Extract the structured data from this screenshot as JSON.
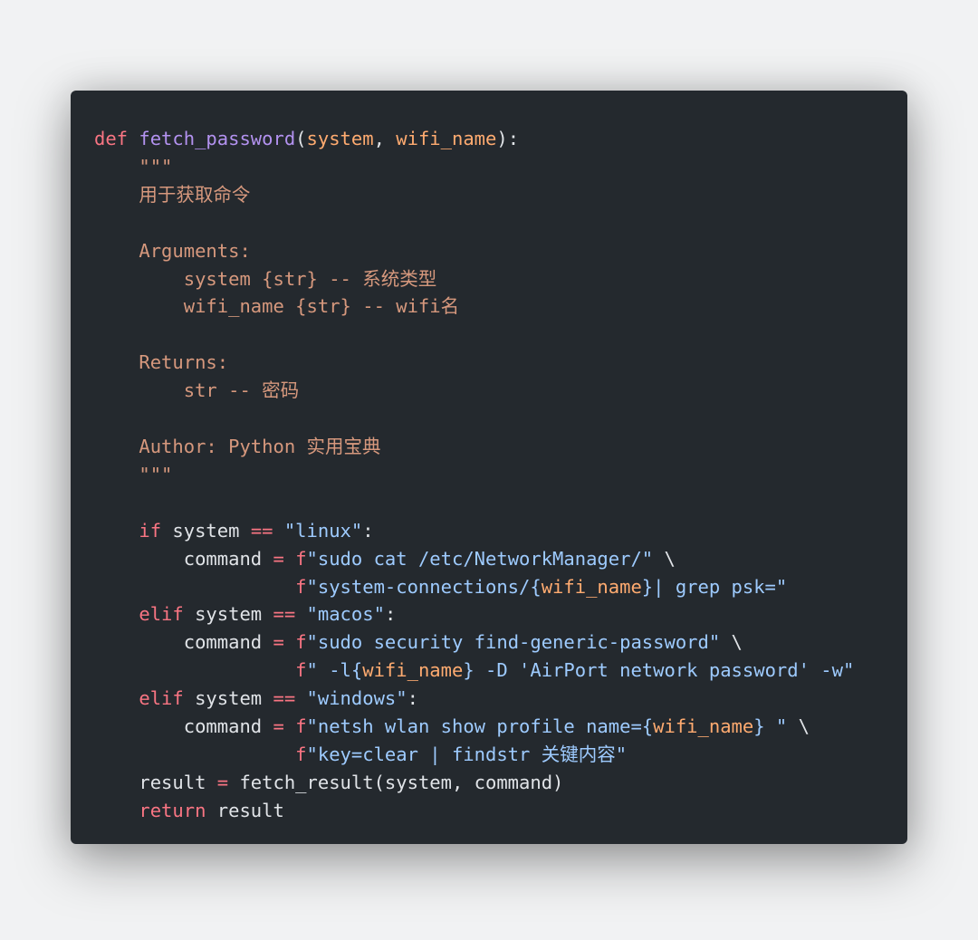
{
  "code": {
    "line01": {
      "def": "def",
      "sp1": " ",
      "fn": "fetch_password",
      "lp": "(",
      "arg1": "system",
      "comma": ", ",
      "arg2": "wifi_name",
      "rp": ")",
      "colon": ":"
    },
    "line02": {
      "indent": "    ",
      "q": "\"\"\""
    },
    "line03": {
      "indent": "    ",
      "t": "用于获取命令"
    },
    "line04": {
      "indent": ""
    },
    "line05": {
      "indent": "    ",
      "t": "Arguments:"
    },
    "line06": {
      "indent": "        ",
      "t": "system {str} -- 系统类型"
    },
    "line07": {
      "indent": "        ",
      "t": "wifi_name {str} -- wifi名"
    },
    "line08": {
      "indent": ""
    },
    "line09": {
      "indent": "    ",
      "t": "Returns:"
    },
    "line10": {
      "indent": "        ",
      "t": "str -- 密码"
    },
    "line11": {
      "indent": ""
    },
    "line12": {
      "indent": "    ",
      "t": "Author: Python 实用宝典"
    },
    "line13": {
      "indent": "    ",
      "q": "\"\"\""
    },
    "line14": {
      "indent": ""
    },
    "line15": {
      "indent": "    ",
      "ifkw": "if",
      "sp1": " ",
      "var": "system",
      "sp2": " ",
      "op": "==",
      "sp3": " ",
      "s": "\"linux\"",
      "colon": ":"
    },
    "line16": {
      "indent": "        ",
      "var": "command",
      "sp1": " ",
      "op": "=",
      "sp2": " ",
      "f": "f",
      "s": "\"sudo cat /etc/NetworkManager/\"",
      "sp3": " ",
      "bs": "\\"
    },
    "line17": {
      "indent": "                  ",
      "f": "f",
      "s1": "\"system-connections/",
      "lb": "{",
      "arg": "wifi_name",
      "rb": "}",
      "s2": "| grep psk=\""
    },
    "line18": {
      "indent": "    ",
      "elif": "elif",
      "sp1": " ",
      "var": "system",
      "sp2": " ",
      "op": "==",
      "sp3": " ",
      "s": "\"macos\"",
      "colon": ":"
    },
    "line19": {
      "indent": "        ",
      "var": "command",
      "sp1": " ",
      "op": "=",
      "sp2": " ",
      "f": "f",
      "s": "\"sudo security find-generic-password\"",
      "sp3": " ",
      "bs": "\\"
    },
    "line20": {
      "indent": "                  ",
      "f": "f",
      "s1": "\" -l",
      "lb": "{",
      "arg": "wifi_name",
      "rb": "}",
      "s2": " -D 'AirPort network password' -w\""
    },
    "line21": {
      "indent": "    ",
      "elif": "elif",
      "sp1": " ",
      "var": "system",
      "sp2": " ",
      "op": "==",
      "sp3": " ",
      "s": "\"windows\"",
      "colon": ":"
    },
    "line22": {
      "indent": "        ",
      "var": "command",
      "sp1": " ",
      "op": "=",
      "sp2": " ",
      "f": "f",
      "s1": "\"netsh wlan show profile name=",
      "lb": "{",
      "arg": "wifi_name",
      "rb": "}",
      "s2": " \"",
      "sp3": " ",
      "bs": "\\"
    },
    "line23": {
      "indent": "                  ",
      "f": "f",
      "s": "\"key=clear | findstr 关键内容\""
    },
    "line24": {
      "indent": "    ",
      "var": "result",
      "sp1": " ",
      "op": "=",
      "sp2": " ",
      "call": "fetch_result(system, command)"
    },
    "line25": {
      "indent": "    ",
      "ret": "return",
      "sp1": " ",
      "var": "result"
    }
  }
}
